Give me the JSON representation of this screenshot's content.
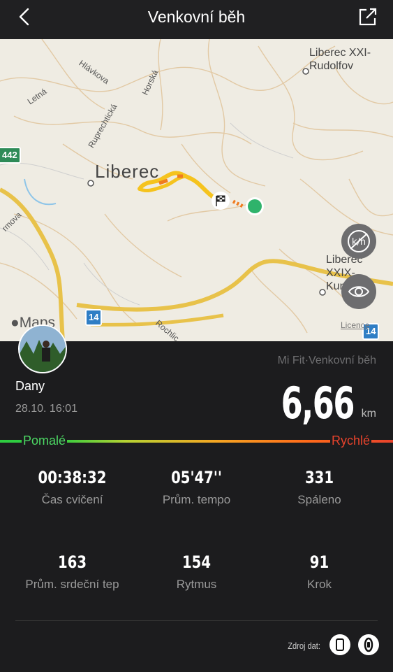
{
  "header": {
    "title": "Venkovní běh"
  },
  "map": {
    "labels": {
      "liberec": "Liberec",
      "rudolfov": "Liberec XXI-\nRudolfov",
      "kunratice": "Liberec\nXXIX-\nKunratice",
      "hlavkova": "Hlávkova",
      "horska": "Horská",
      "letna": "Letná",
      "ruprechticka": "Ruprechtická",
      "rmova": "rmova",
      "rochlice": "Rochlic",
      "maps": "Maps",
      "legal": "Licence"
    },
    "road_shields": {
      "r442": "442",
      "r14a": "14",
      "r14b": "14"
    },
    "colors": {
      "route_fast": "#f5c31e",
      "route_slow": "#f07b1e",
      "end_marker": "#2fb36b"
    }
  },
  "profile": {
    "name": "Dany",
    "datetime": "28.10. 16:01",
    "source": "Mi Fit·Venkovní běh",
    "distance_value": "6,66",
    "distance_unit": "km"
  },
  "speed_scale": {
    "slow": "Pomalé",
    "fast": "Rychlé"
  },
  "stats": [
    {
      "value": "00:38:32",
      "label": "Čas cvičení"
    },
    {
      "value": "05'47''",
      "label": "Prům. tempo"
    },
    {
      "value": "331",
      "label": "Spáleno"
    },
    {
      "value": "163",
      "label": "Prům. srdeční tep"
    },
    {
      "value": "154",
      "label": "Rytmus"
    },
    {
      "value": "91",
      "label": "Krok"
    }
  ],
  "footer": {
    "source_label": "Zdroj dat:"
  },
  "icons": [
    "back-icon",
    "share-icon",
    "hide-map-icon",
    "eye-icon",
    "phone-icon",
    "band-icon",
    "finish-flag-icon"
  ]
}
